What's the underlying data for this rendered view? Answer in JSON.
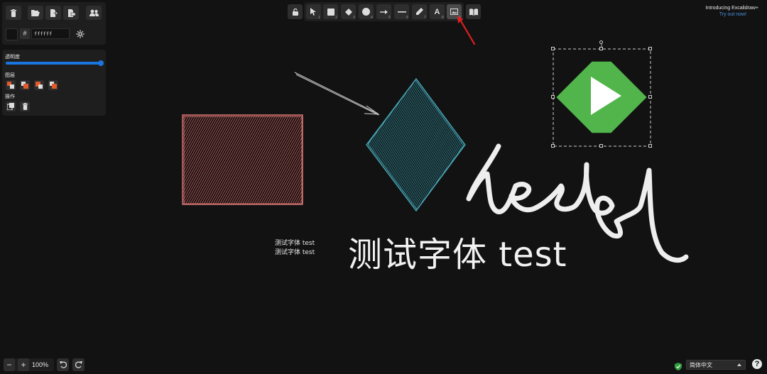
{
  "props": {
    "color_hex_symbol": "#",
    "color_value": "ffffff",
    "opacity_label": "透明度",
    "opacity_value": 100,
    "layer_label": "图层",
    "actions_label": "操作"
  },
  "toolbar": {
    "shortcuts": [
      "1",
      "2",
      "3",
      "4",
      "5",
      "6",
      "7",
      "8",
      "9"
    ]
  },
  "promo": {
    "title": "Introducing Excalidraw+",
    "link": "Try out now!"
  },
  "canvas": {
    "small_text_line1": "测试字体 test",
    "small_text_line2": "测试字体 test",
    "big_text": "测试字体 test"
  },
  "footer": {
    "zoom_out": "−",
    "zoom_in": "+",
    "zoom_level": "100%",
    "language": "简体中文",
    "help": "?"
  },
  "colors": {
    "background": "#121212",
    "panel": "#1e1e1e",
    "accent_blue": "#1976e0",
    "rect_stroke": "#e07a77",
    "diamond_stroke": "#4aa8b8",
    "emby_green": "#52b54b",
    "annotation_red": "#e02020"
  },
  "icons": {
    "delete": "trash-icon",
    "open": "folder-open-icon",
    "export": "export-icon",
    "save_as": "save-as-icon",
    "collab": "users-icon",
    "lock": "lock-icon",
    "library": "book-icon",
    "shield": "shield-check-icon"
  }
}
